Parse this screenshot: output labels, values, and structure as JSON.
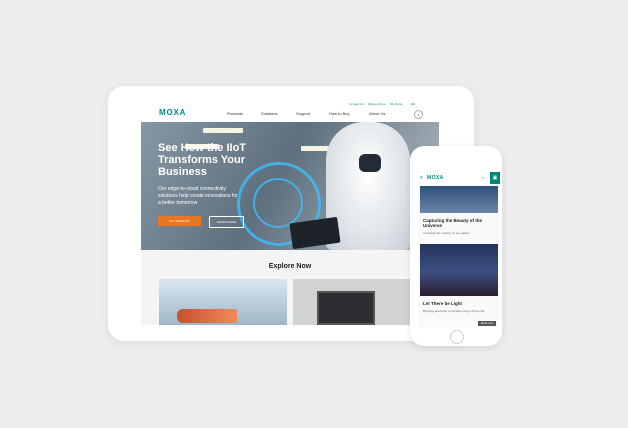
{
  "site": {
    "logo": "MOXA"
  },
  "tablet": {
    "utility_links": [
      "Contact Us",
      "Partner Zone",
      "My Moxa",
      "EN"
    ],
    "menu": [
      "Products",
      "Solutions",
      "Support",
      "How to Buy",
      "About Us"
    ],
    "hero": {
      "title_prefix": "See How the ",
      "title_highlight": "IIoT",
      "title_line2": "Transforms Your",
      "title_line3": "Business",
      "subtitle": "Our edge-to-cloud connectivity solutions help create innovations for a better tomorrow",
      "primary_button": "IIoT INSIGHTS",
      "secondary_button": "LEARN MORE"
    },
    "explore_heading": "Explore Now"
  },
  "phone": {
    "articles": [
      {
        "title": "Capturing the Beauty of the Universe",
        "desc": "Unveiling the mystery of our galaxy"
      },
      {
        "title": "Let There be Light",
        "desc": "Bringing electricity to families living off the grid"
      }
    ],
    "tag": "Read more"
  },
  "colors": {
    "brand": "#008b8b",
    "cta": "#e87722",
    "phone_button": "#00897b"
  }
}
